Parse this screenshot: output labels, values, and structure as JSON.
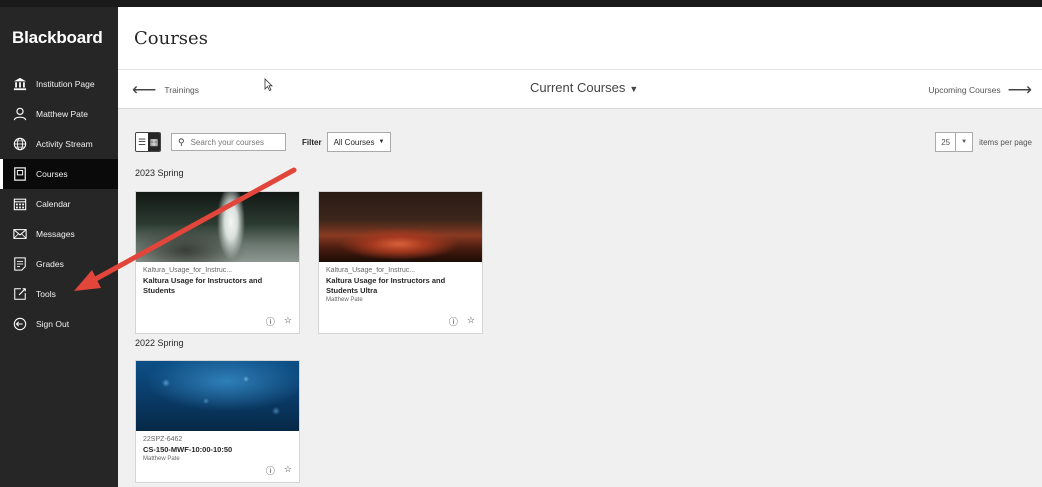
{
  "brand": "Blackboard",
  "sidebar": {
    "items": [
      {
        "label": "Institution Page",
        "icon": "institution-icon"
      },
      {
        "label": "Matthew Pate",
        "icon": "user-icon"
      },
      {
        "label": "Activity Stream",
        "icon": "globe-icon"
      },
      {
        "label": "Courses",
        "icon": "courses-icon",
        "active": true
      },
      {
        "label": "Calendar",
        "icon": "calendar-icon"
      },
      {
        "label": "Messages",
        "icon": "envelope-icon"
      },
      {
        "label": "Grades",
        "icon": "grades-icon"
      },
      {
        "label": "Tools",
        "icon": "tools-icon"
      },
      {
        "label": "Sign Out",
        "icon": "signout-icon"
      }
    ]
  },
  "header": {
    "title": "Courses"
  },
  "subnav": {
    "back": "Trainings",
    "current": "Current Courses",
    "next": "Upcoming Courses"
  },
  "toolbar": {
    "search_placeholder": "Search your courses",
    "filter_label": "Filter",
    "filter_value": "All Courses",
    "per_page_value": "25",
    "per_page_label": "items per page"
  },
  "sections": [
    {
      "title": "2023 Spring",
      "cards": [
        {
          "id": "Kaltura_Usage_for_Instruc...",
          "name": "Kaltura Usage for Instructors and Students",
          "instructor": ""
        },
        {
          "id": "Kaltura_Usage_for_Instruc...",
          "name": "Kaltura Usage for Instructors and Students Ultra",
          "instructor": "Matthew Pate"
        }
      ]
    },
    {
      "title": "2022 Spring",
      "cards": [
        {
          "id": "22SPZ-6462",
          "name": "CS-150-MWF-10:00-10:50",
          "instructor": "Matthew Pate"
        }
      ]
    }
  ],
  "colors": {
    "sidebar": "#262626",
    "annotation_arrow": "#e2463a",
    "background": "#f0f0f0"
  }
}
